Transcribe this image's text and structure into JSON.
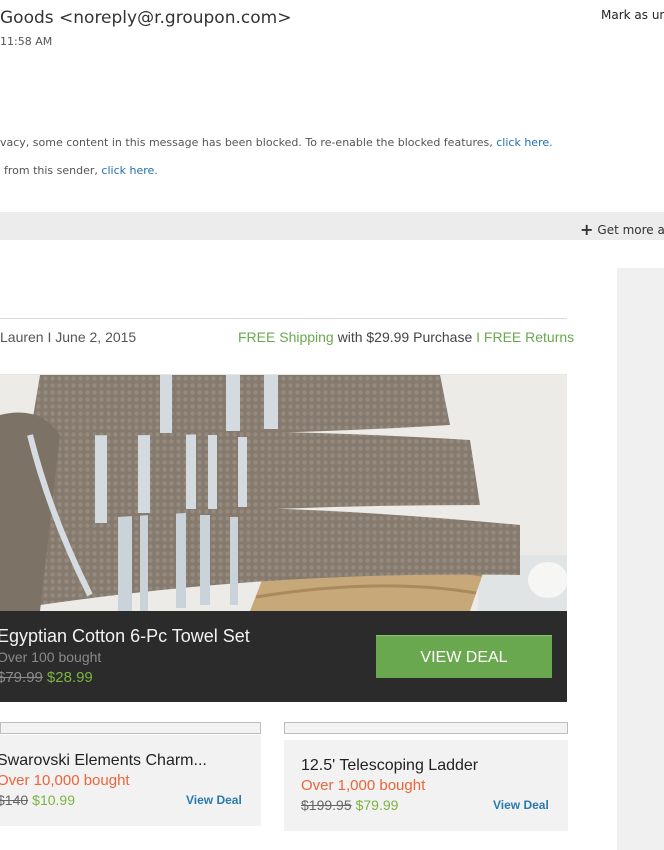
{
  "header": {
    "sender": "Goods <noreply@r.groupon.com>",
    "time": "11:58 AM",
    "mark_unread": "Mark as unr"
  },
  "notices": {
    "blocked_text": "vacy, some content in this message has been blocked. To re-enable the blocked features,",
    "blocked_link": "click here.",
    "sender_text": "from this sender,",
    "sender_link": "click here."
  },
  "apps_bar": {
    "label": "Get more app"
  },
  "email": {
    "byline": "Lauren I June 2, 2015",
    "shipping": {
      "free_shipping": "FREE Shipping",
      "with_purchase": "with $29.99 Purchase",
      "separator": "I",
      "free_returns": "FREE Returns"
    },
    "featured": {
      "title": "Egyptian Cotton 6-Pc Towel Set",
      "bought": "Over 100 bought",
      "old_price": "$79.99",
      "new_price": "$28.99",
      "button": "VIEW DEAL"
    },
    "cards": [
      {
        "title": "Swarovski Elements Charm...",
        "bought": "Over 10,000 bought",
        "old_price": "$140",
        "new_price": "$10.99",
        "link": "View Deal"
      },
      {
        "title": "12.5' Telescoping Ladder",
        "bought": "Over 1,000 bought",
        "old_price": "$199.95",
        "new_price": "$79.99",
        "link": "View Deal"
      }
    ]
  },
  "colors": {
    "accent_green": "#6aa84f",
    "price_green": "#7cb342",
    "bought_orange": "#e8663a",
    "link_blue": "#1f6fb0"
  }
}
